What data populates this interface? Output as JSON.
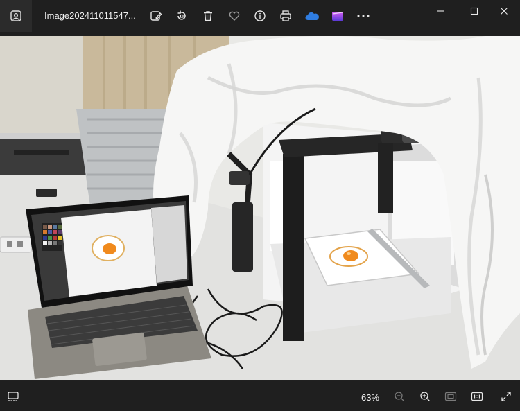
{
  "window": {
    "title": "Image202411011547..."
  },
  "toolbar": {
    "icons": [
      "edit-image-icon",
      "rotate-icon",
      "delete-icon",
      "favorite-icon",
      "info-icon",
      "print-icon",
      "onedrive-icon",
      "clipchamp-icon",
      "more-icon"
    ]
  },
  "window_controls": [
    "minimize-icon",
    "maximize-icon",
    "close-icon"
  ],
  "statusbar": {
    "zoom": "63%"
  },
  "colors": {
    "chrome": "#1f1f1f",
    "onedrive": "#2f7de1",
    "clipchamp_top": "#d45cf3",
    "clipchamp_bottom": "#5b3bd6"
  }
}
